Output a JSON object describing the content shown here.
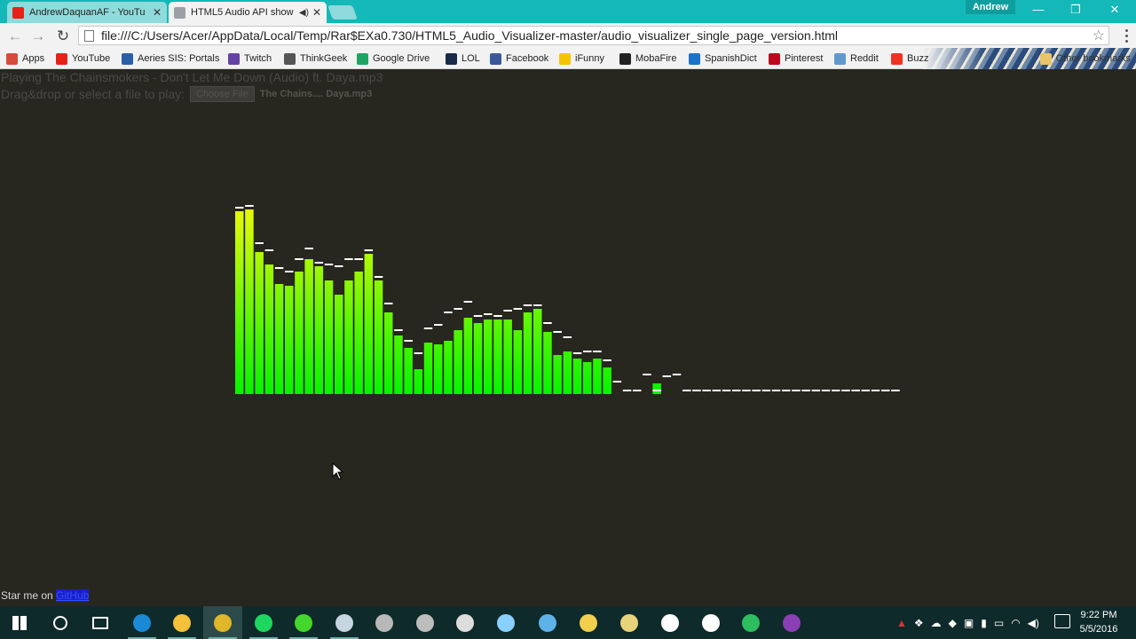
{
  "window": {
    "profile_name": "Andrew",
    "minimize_glyph": "—",
    "restore_glyph": "❐",
    "close_glyph": "✕"
  },
  "tabs": [
    {
      "label": "AndrewDaquanAF - YouTu",
      "favicon": "youtube-icon",
      "favicon_color": "#e62117",
      "active": false
    },
    {
      "label": "HTML5 Audio API show",
      "favicon": "page-icon",
      "favicon_color": "#9aa0a6",
      "active": true
    }
  ],
  "toolbar": {
    "back_glyph": "←",
    "forward_glyph": "→",
    "reload_glyph": "↻",
    "url": "file:///C:/Users/Acer/AppData/Local/Temp/Rar$EXa0.730/HTML5_Audio_Visualizer-master/audio_visualizer_single_page_version.html",
    "star_glyph": "☆"
  },
  "bookmarks": [
    {
      "label": "Apps",
      "icon": "apps-grid-icon",
      "color": "#d64b3b"
    },
    {
      "label": "YouTube",
      "icon": "youtube-icon",
      "color": "#e62117"
    },
    {
      "label": "Aeries SIS: Portals",
      "icon": "aeries-icon",
      "color": "#2b5fa8"
    },
    {
      "label": "Twitch",
      "icon": "twitch-icon",
      "color": "#6441a5"
    },
    {
      "label": "ThinkGeek",
      "icon": "thinkgeek-icon",
      "color": "#555555"
    },
    {
      "label": "Google Drive",
      "icon": "google-drive-icon",
      "color": "#1fa463"
    },
    {
      "label": "LOL",
      "icon": "lol-icon",
      "color": "#1a2a4a"
    },
    {
      "label": "Facebook",
      "icon": "facebook-icon",
      "color": "#3b5998"
    },
    {
      "label": "iFunny",
      "icon": "ifunny-icon",
      "color": "#f5c400"
    },
    {
      "label": "MobaFire",
      "icon": "mobafire-icon",
      "color": "#222222"
    },
    {
      "label": "SpanishDict",
      "icon": "spanishdict-icon",
      "color": "#1a73c9"
    },
    {
      "label": "Pinterest",
      "icon": "pinterest-icon",
      "color": "#bd081c"
    },
    {
      "label": "Reddit",
      "icon": "reddit-icon",
      "color": "#5f99cf"
    },
    {
      "label": "Buzz",
      "icon": "buzzfeed-icon",
      "color": "#ee3322"
    }
  ],
  "other_bookmarks": "Other bookmarks",
  "page": {
    "playing_text": "Playing The Chainsmokers - Don't Let Me Down (Audio) ft. Daya.mp3",
    "drop_label": "Drag&drop or select a file to play:",
    "choose_file_label": "Choose File",
    "selected_file": "The Chains.... Daya.mp3",
    "star_prefix": "Star me on",
    "star_link": "GitHub"
  },
  "chart_data": {
    "type": "bar",
    "values": [
      206,
      208,
      160,
      146,
      124,
      122,
      138,
      152,
      144,
      128,
      112,
      128,
      138,
      158,
      128,
      92,
      66,
      52,
      28,
      58,
      56,
      60,
      72,
      86,
      80,
      84,
      84,
      84,
      72,
      92,
      96,
      70,
      44,
      48,
      40,
      36,
      40,
      30,
      2,
      2,
      2,
      2,
      12,
      2,
      2,
      2,
      2,
      2,
      2,
      2,
      2,
      2,
      2,
      2,
      2,
      2,
      2,
      2,
      2,
      2,
      2,
      2,
      2,
      2,
      2,
      2,
      2
    ],
    "caps": [
      208,
      210,
      168,
      160,
      140,
      136,
      150,
      162,
      146,
      144,
      142,
      150,
      150,
      160,
      130,
      100,
      70,
      58,
      44,
      72,
      76,
      90,
      94,
      102,
      86,
      88,
      86,
      92,
      94,
      98,
      98,
      78,
      68,
      62,
      44,
      46,
      46,
      36,
      12,
      2,
      2,
      20,
      2,
      18,
      20,
      2,
      2,
      2,
      2,
      2,
      2,
      2,
      2,
      2,
      2,
      2,
      2,
      2,
      2,
      2,
      2,
      2,
      2,
      2,
      2,
      2,
      2
    ],
    "colors": {
      "top": "#eef80a",
      "bottom": "#05f400",
      "cap": "#ffffff"
    }
  },
  "taskbar": {
    "items": [
      {
        "icon": "windows-start-icon",
        "color": "#ffffff"
      },
      {
        "icon": "cortana-search-icon",
        "color": "#ffffff"
      },
      {
        "icon": "task-view-icon",
        "color": "#ffffff"
      },
      {
        "icon": "edge-icon",
        "color": "#1a8ad6"
      },
      {
        "icon": "file-explorer-icon",
        "color": "#f3c13a"
      },
      {
        "icon": "chrome-icon",
        "color": "#e0b62a",
        "active": true
      },
      {
        "icon": "spotify-icon",
        "color": "#1ed760"
      },
      {
        "icon": "razer-icon",
        "color": "#44d62c"
      },
      {
        "icon": "steam-icon",
        "color": "#c7d5e0"
      },
      {
        "icon": "shield-icon",
        "color": "#b8b8b8"
      },
      {
        "icon": "film-icon",
        "color": "#bdbdbd"
      },
      {
        "icon": "obs-icon",
        "color": "#dddddd"
      },
      {
        "icon": "character-icon",
        "color": "#8ad0ff"
      },
      {
        "icon": "window-icon",
        "color": "#5db2e8"
      },
      {
        "icon": "folder-icon",
        "color": "#f2d04e"
      },
      {
        "icon": "paint-icon",
        "color": "#e8d27a"
      },
      {
        "icon": "chess-icon",
        "color": "#ffffff"
      },
      {
        "icon": "groove-icon",
        "color": "#ffffff"
      },
      {
        "icon": "evernote-icon",
        "color": "#2dbe60"
      },
      {
        "icon": "winrar-icon",
        "color": "#8a3fb4"
      }
    ],
    "time": "9:22 PM",
    "date": "5/5/2016"
  }
}
